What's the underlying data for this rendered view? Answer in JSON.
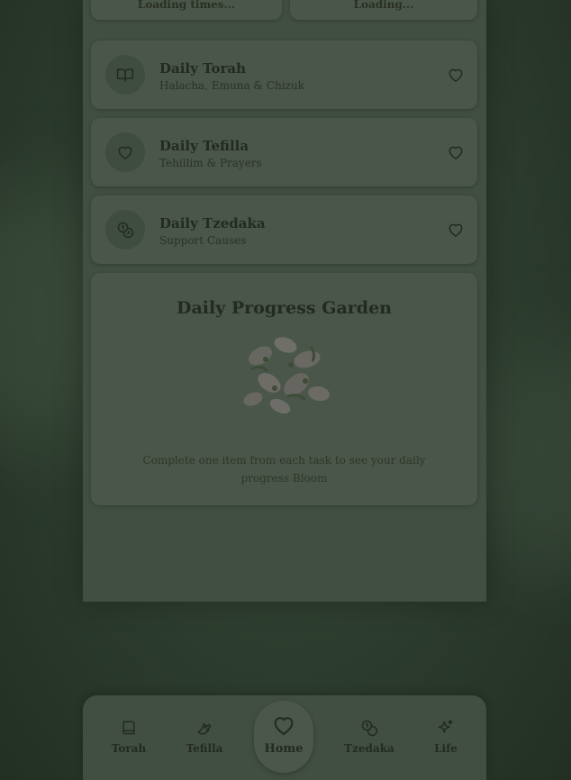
{
  "top_cards": [
    {
      "text": "Loading times..."
    },
    {
      "text": "Loading..."
    }
  ],
  "tasks": [
    {
      "title": "Daily Torah",
      "subtitle": "Halacha, Emuna & Chizuk",
      "icon": "book-icon"
    },
    {
      "title": "Daily Tefilla",
      "subtitle": "Tehillim & Prayers",
      "icon": "heart-icon"
    },
    {
      "title": "Daily Tzedaka",
      "subtitle": "Support Causes",
      "icon": "coins-icon"
    }
  ],
  "garden": {
    "title": "Daily Progress Garden",
    "message": "Complete one item from each task to see your daily progress Bloom"
  },
  "nav": {
    "items": [
      {
        "label": "Torah",
        "icon": "book-icon"
      },
      {
        "label": "Tefilla",
        "icon": "praying-hands-icon"
      },
      {
        "label": "Home",
        "icon": "heart-icon"
      },
      {
        "label": "Tzedaka",
        "icon": "coins-icon"
      },
      {
        "label": "Life",
        "icon": "sparkles-icon"
      }
    ],
    "active": "Home"
  },
  "colors": {
    "overlay_bg": "#2b3a2d",
    "card_bg": "#4a5649",
    "text_dark": "#232a20"
  }
}
